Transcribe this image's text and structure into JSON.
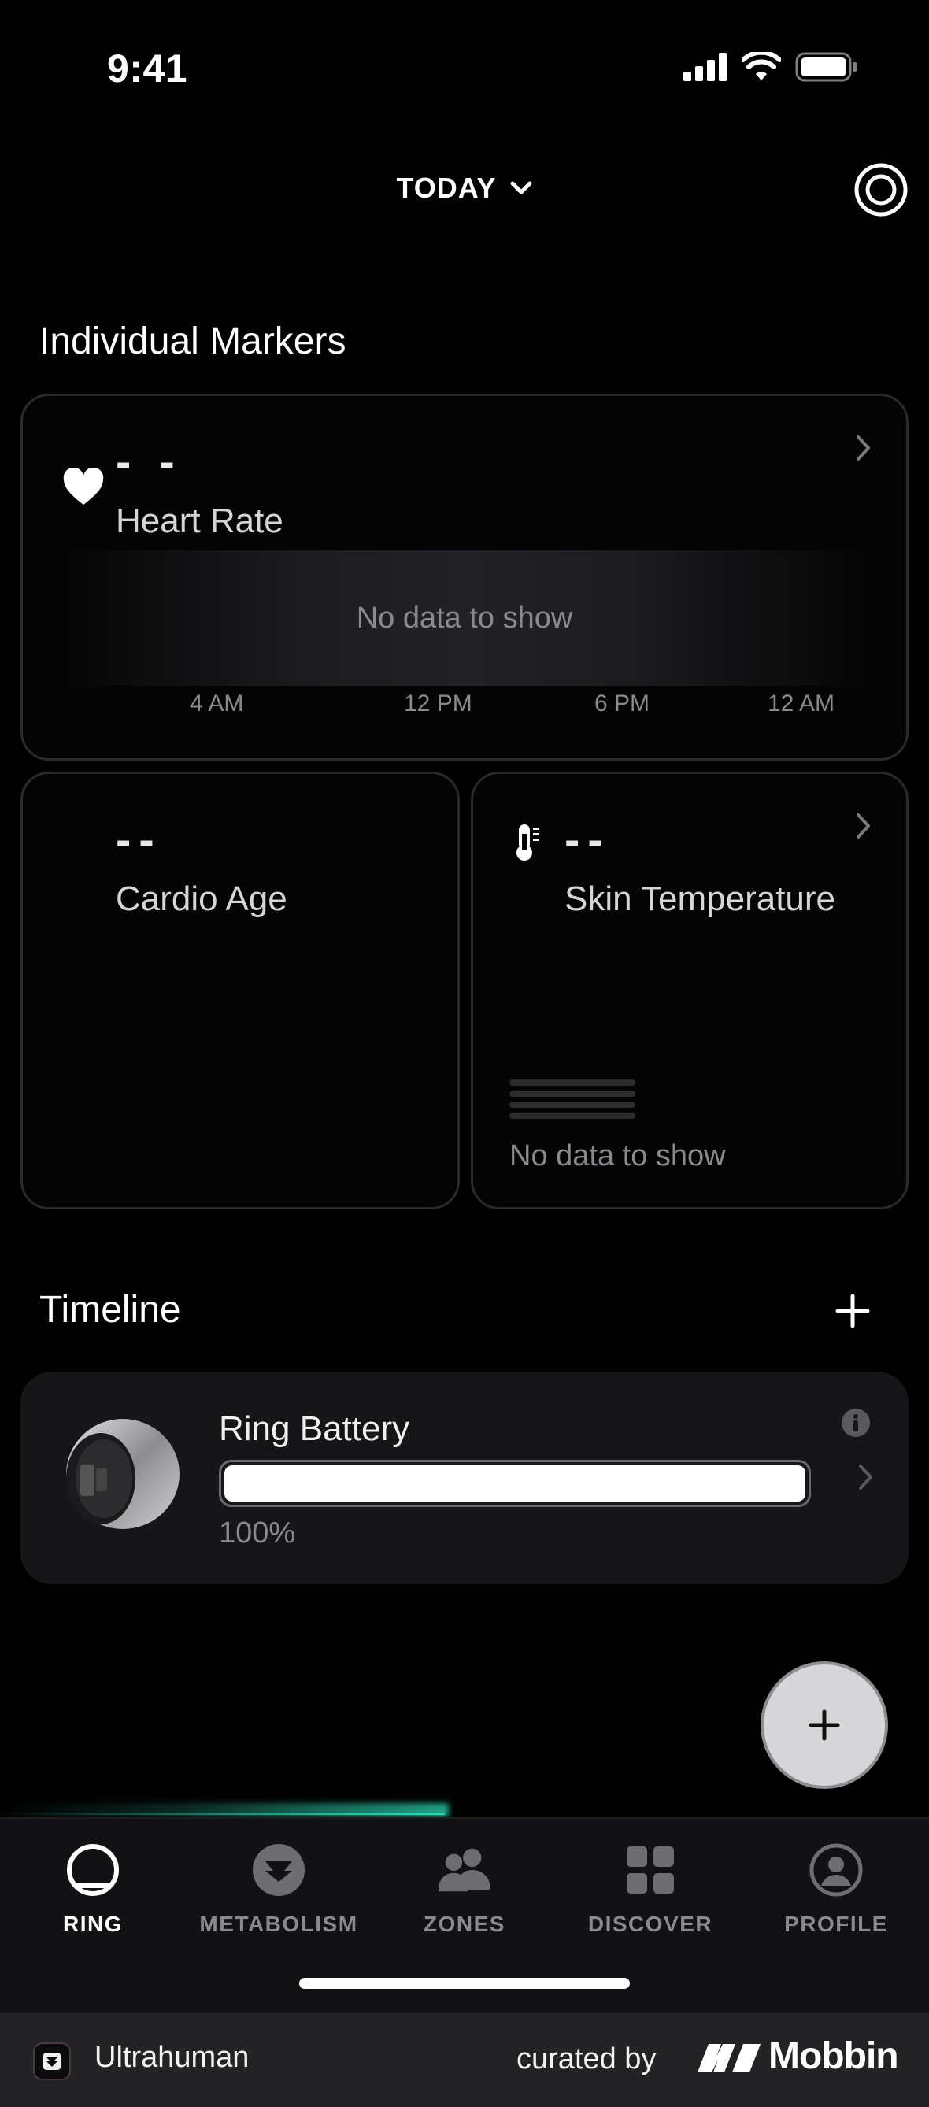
{
  "status_bar": {
    "time": "9:41"
  },
  "header": {
    "period_label": "TODAY"
  },
  "markers": {
    "section_title": "Individual Markers",
    "heart_rate": {
      "value": "- -",
      "label": "Heart Rate",
      "empty_text": "No data to show",
      "axis_ticks": [
        "4 AM",
        "12 PM",
        "6 PM",
        "12 AM"
      ]
    },
    "cardio_age": {
      "value": "--",
      "label": "Cardio Age"
    },
    "skin_temperature": {
      "value": "--",
      "label": "Skin Temperature",
      "empty_text": "No data to show"
    }
  },
  "timeline": {
    "section_title": "Timeline",
    "ring_battery": {
      "label": "Ring Battery",
      "percent_text": "100%",
      "level": 1.0
    }
  },
  "tabs": [
    {
      "label": "RING",
      "icon": "ring-icon",
      "active": true
    },
    {
      "label": "METABOLISM",
      "icon": "metabolism-icon",
      "active": false
    },
    {
      "label": "ZONES",
      "icon": "zones-icon",
      "active": false
    },
    {
      "label": "DISCOVER",
      "icon": "discover-icon",
      "active": false
    },
    {
      "label": "PROFILE",
      "icon": "profile-icon",
      "active": false
    }
  ],
  "footer": {
    "app_name": "Ultrahuman",
    "curated_by": "curated by",
    "brand": "Mobbin"
  },
  "colors": {
    "background": "#000000",
    "card_border": "#2a2a2c",
    "accent_glow": "#27d7b4",
    "muted_text": "#8a8a8e"
  }
}
